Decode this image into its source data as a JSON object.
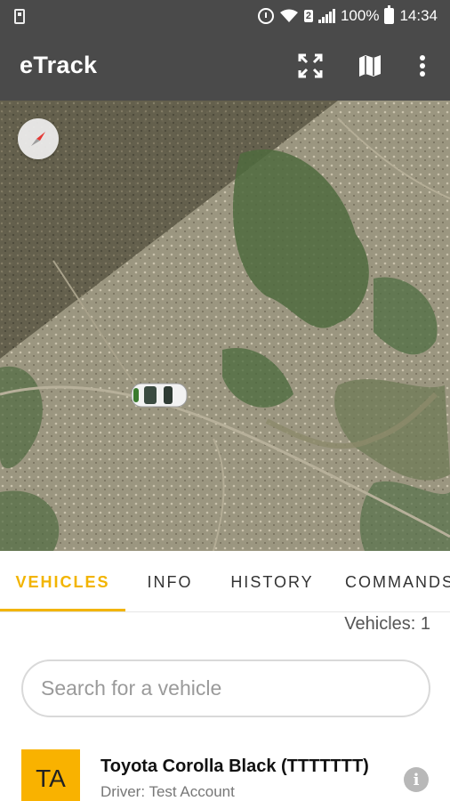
{
  "status_bar": {
    "sim_slot": "2",
    "battery": "100%",
    "time": "14:34",
    "icons": [
      "sim-card-icon",
      "alarm-icon",
      "wifi-icon",
      "signal-icon",
      "battery-icon"
    ]
  },
  "app_bar": {
    "title": "eTrack",
    "actions": [
      "fullscreen-icon",
      "map-icon",
      "more-vert-icon"
    ]
  },
  "map": {
    "type": "satellite",
    "controls": [
      "compass-icon"
    ],
    "markers": [
      "car-marker"
    ]
  },
  "tabs": [
    {
      "label": "VEHICLES",
      "active": true
    },
    {
      "label": "INFO",
      "active": false
    },
    {
      "label": "HISTORY",
      "active": false
    },
    {
      "label": "COMMANDS",
      "active": false
    }
  ],
  "vehicles_panel": {
    "count_text": "Vehicles: 1",
    "search": {
      "placeholder": "Search for a vehicle",
      "value": ""
    },
    "items": [
      {
        "initials": "TA",
        "name": "Toyota Corolla Black (TTTTTTT)",
        "driver": "Driver: Test Account",
        "action_icon": "info-icon"
      }
    ]
  },
  "colors": {
    "app_bar": "#4a4a4a",
    "accent": "#f2b400",
    "avatar_bg": "#f9b200"
  }
}
